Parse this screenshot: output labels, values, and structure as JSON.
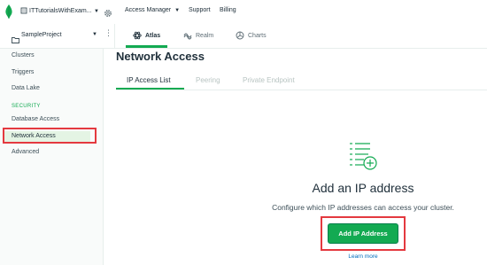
{
  "topbar": {
    "org_name": "ITTutorialsWithExam...",
    "links": [
      "Access Manager",
      "Support",
      "Billing"
    ]
  },
  "project_bar": {
    "project_name": "SampleProject",
    "tabs": [
      "Atlas",
      "Realm",
      "Charts"
    ]
  },
  "sidebar": {
    "items_top": [
      "Clusters",
      "Triggers",
      "Data Lake"
    ],
    "section_label": "SECURITY",
    "items_security": [
      "Database Access",
      "Network Access",
      "Advanced"
    ]
  },
  "main": {
    "title": "Network Access",
    "tabs": [
      "IP Access List",
      "Peering",
      "Private Endpoint"
    ],
    "empty_title": "Add an IP address",
    "empty_description": "Configure which IP addresses can access your cluster.",
    "add_button": "Add IP Address",
    "learn_more": "Learn more"
  },
  "colors": {
    "accent": "#13aa52",
    "highlight": "#e4393f",
    "link": "#006cbc"
  }
}
